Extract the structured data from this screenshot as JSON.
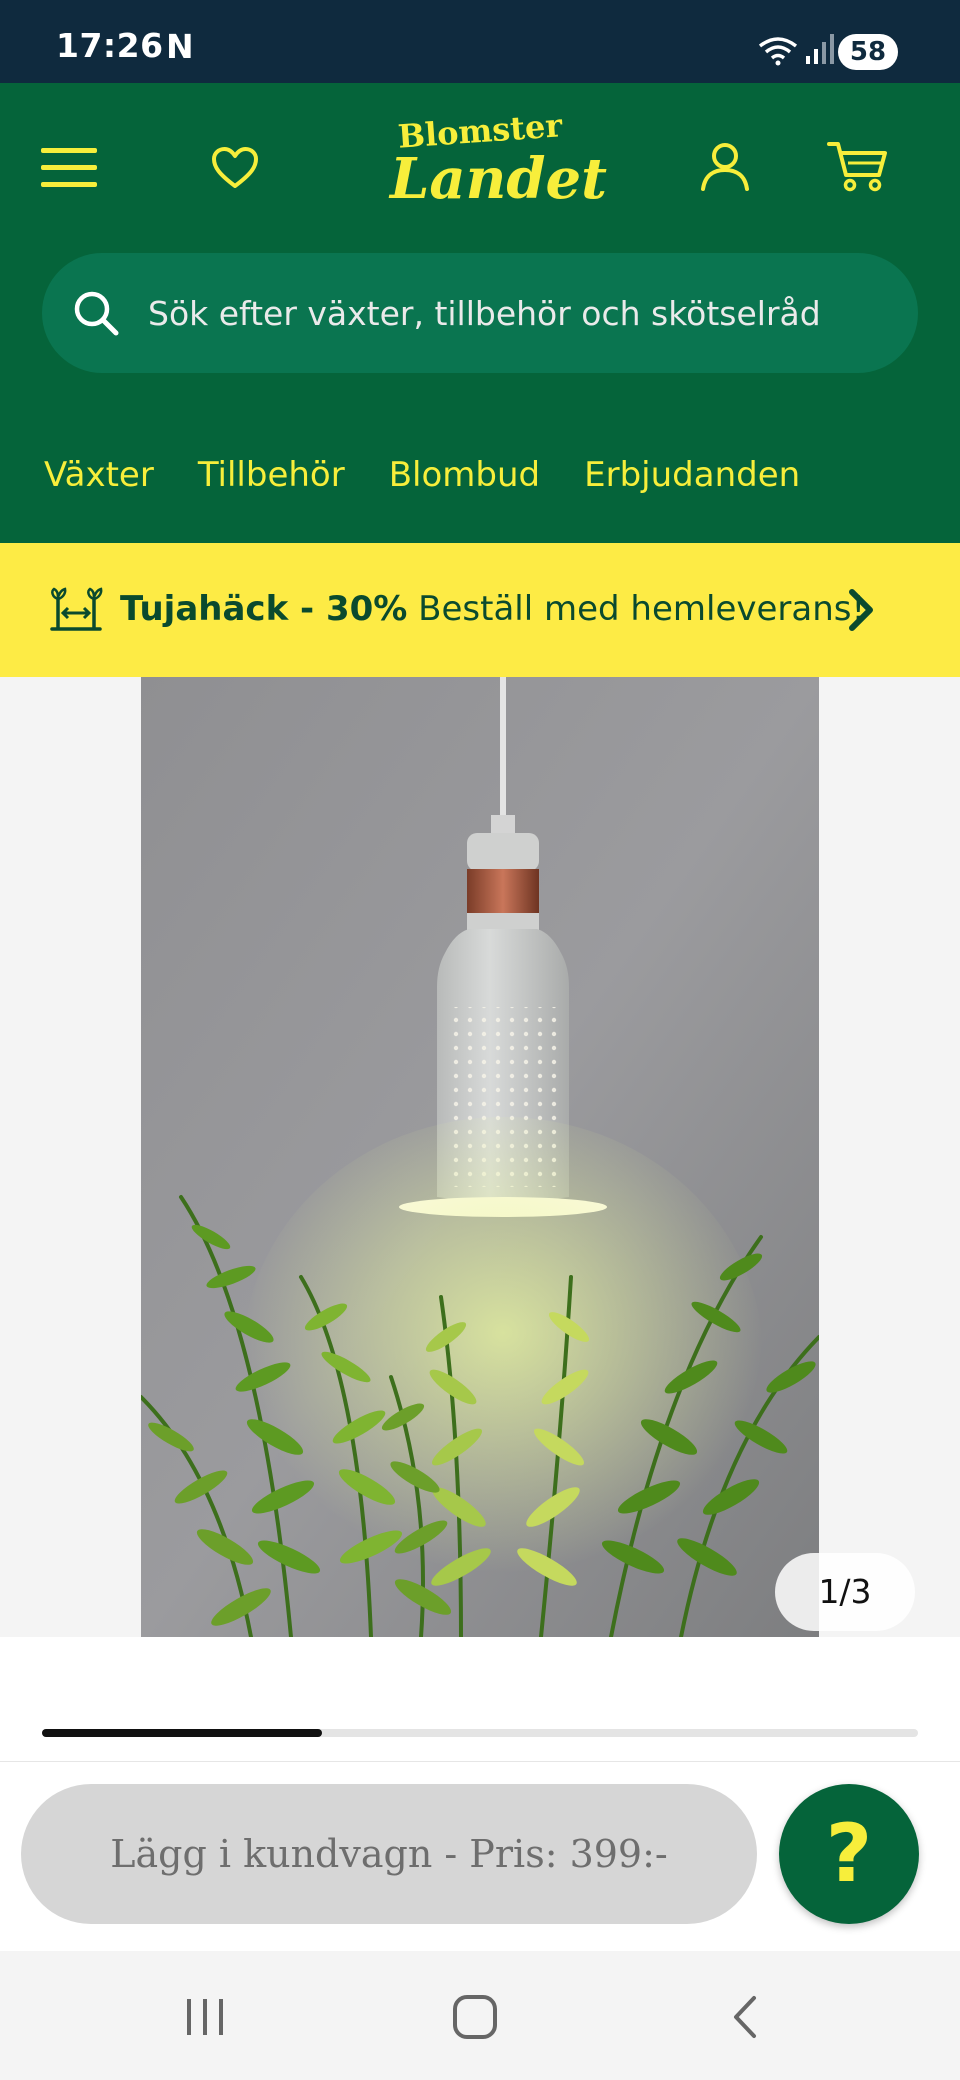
{
  "status_bar": {
    "time": "17:26",
    "notification_letter": "N",
    "battery": "58"
  },
  "header": {
    "logo_top": "Blomster",
    "logo_bottom": "Landet",
    "search_placeholder": "Sök efter växter, tillbehör och skötselråd",
    "nav": [
      "Växter",
      "Tillbehör",
      "Blombud",
      "Erbjudanden"
    ]
  },
  "promo": {
    "bold_text": "Tujahäck - 30%",
    "text": "Beställ med hemleverans!"
  },
  "gallery": {
    "counter": "1/3",
    "image_progress": 0.32
  },
  "actions": {
    "add_to_cart": "Lägg i kundvagn - Pris: 399:-",
    "help": "?"
  },
  "colors": {
    "brand_green": "#05643a",
    "brand_yellow": "#f7ee3b",
    "promo_yellow": "#fdeb45",
    "status_navy": "#0f2a3e"
  }
}
